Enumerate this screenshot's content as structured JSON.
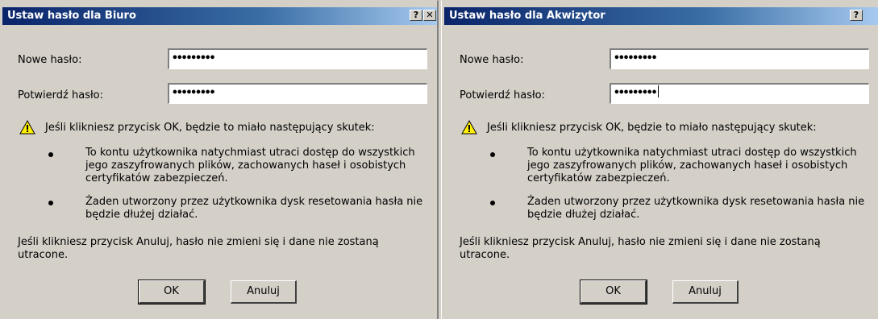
{
  "dialogs": [
    {
      "title": "Ustaw hasło dla Biuro",
      "new_password_label": "Nowe hasło:",
      "new_password_value": "•••••••••",
      "confirm_password_label": "Potwierdź hasło:",
      "confirm_password_value": "•••••••••",
      "warning_text": "Jeśli klikniesz przycisk OK, będzie to miało następujący skutek:",
      "bullet1": "To kontu użytkownika natychmiast utraci dostęp do wszystkich jego zaszyfrowanych plików, zachowanych haseł i osobistych certyfikatów zabezpieczeń.",
      "bullet2": "Żaden utworzony przez użytkownika dysk resetowania hasła nie będzie dłużej działać.",
      "footer_text": "Jeśli klikniesz przycisk Anuluj, hasło nie zmieni się i dane nie zostaną utracone.",
      "ok_label": "OK",
      "cancel_label": "Anuluj",
      "help_button": "?",
      "close_button": "✕"
    },
    {
      "title": "Ustaw hasło dla Akwizytor",
      "new_password_label": "Nowe hasło:",
      "new_password_value": "•••••••••",
      "confirm_password_label": "Potwierdź hasło:",
      "confirm_password_value": "•••••••••",
      "warning_text": "Jeśli klikniesz przycisk OK, będzie to miało następujący skutek:",
      "bullet1": "To kontu użytkownika natychmiast utraci dostęp do wszystkich jego zaszyfrowanych plików, zachowanych haseł i osobistych certyfikatów zabezpieczeń.",
      "bullet2": "Żaden utworzony przez użytkownika dysk resetowania hasła nie będzie dłużej działać.",
      "footer_text": "Jeśli klikniesz przycisk Anuluj, hasło nie zmieni się i dane nie zostaną utracone.",
      "ok_label": "OK",
      "cancel_label": "Anuluj",
      "help_button": "?"
    }
  ],
  "icons": {
    "warning": "warning-triangle-icon",
    "help": "help-icon",
    "close": "close-icon"
  },
  "colors": {
    "titlebar_start": "#0a246a",
    "titlebar_end": "#a6caf0",
    "face": "#d4d0c8"
  }
}
